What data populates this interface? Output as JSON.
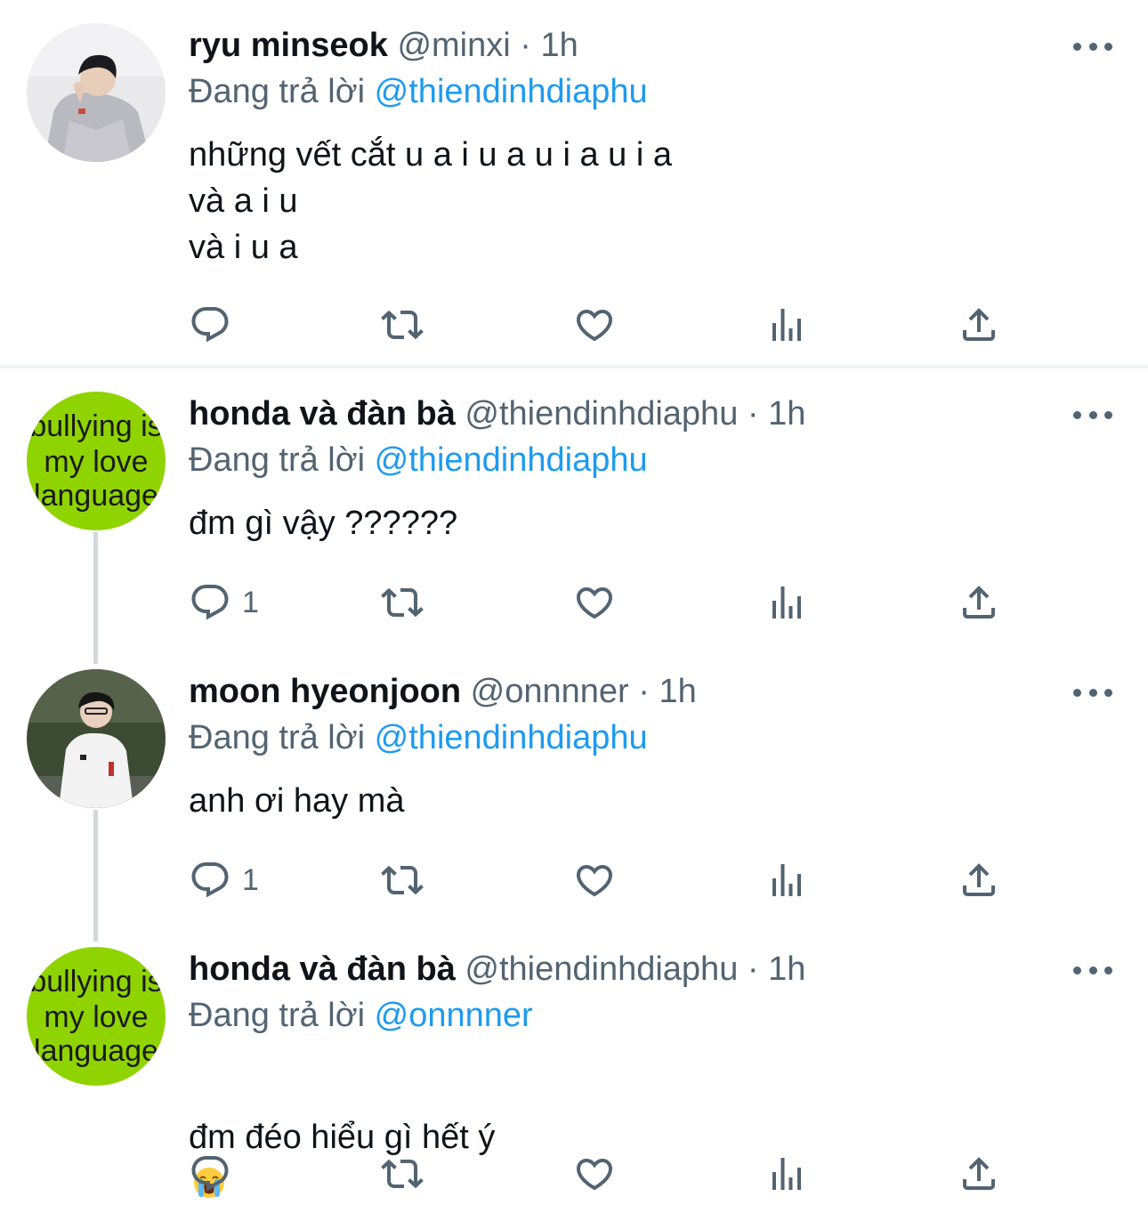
{
  "tweets": [
    {
      "name": "ryu minseok",
      "handle": "@minxi",
      "separator": "·",
      "time": "1h",
      "replying_prefix": "Đang trả lời",
      "replying_to": "@thiendinhdiaphu",
      "text": "những vết cắt u a i u a u i a u i a\nvà a i u\nvà i u a",
      "reply_count": "",
      "avatar": "photo-person-gray-hoodie"
    },
    {
      "name": "honda và đàn bà",
      "handle": "@thiendinhdiaphu",
      "separator": "·",
      "time": "1h",
      "replying_prefix": "Đang trả lời",
      "replying_to": "@thiendinhdiaphu",
      "text": "đm gì vậy ??????",
      "reply_count": "1",
      "avatar_text": [
        "bullying is",
        "my love",
        "language"
      ]
    },
    {
      "name": "moon hyeonjoon",
      "handle": "@onnnner",
      "separator": "·",
      "time": "1h",
      "replying_prefix": "Đang trả lời",
      "replying_to": "@thiendinhdiaphu",
      "text": "anh ơi hay mà",
      "reply_count": "1",
      "avatar": "photo-person-white-jacket"
    },
    {
      "name": "honda và đàn bà",
      "handle": "@thiendinhdiaphu",
      "separator": "·",
      "time": "1h",
      "replying_prefix": "Đang trả lời",
      "replying_to": "@onnnner",
      "text": "đm đéo hiểu gì hết ý",
      "reply_count": "",
      "emoji": "loudly-crying-face",
      "avatar_text": [
        "bullying is",
        "my love",
        "language"
      ]
    }
  ],
  "icons": {
    "reply": "reply-icon",
    "retweet": "retweet-icon",
    "like": "heart-icon",
    "views": "views-icon",
    "share": "share-icon",
    "more": "more-icon"
  },
  "colors": {
    "mention": "#1d9bf0",
    "secondary_text": "#536471",
    "avatar_green": "#8fd400"
  }
}
